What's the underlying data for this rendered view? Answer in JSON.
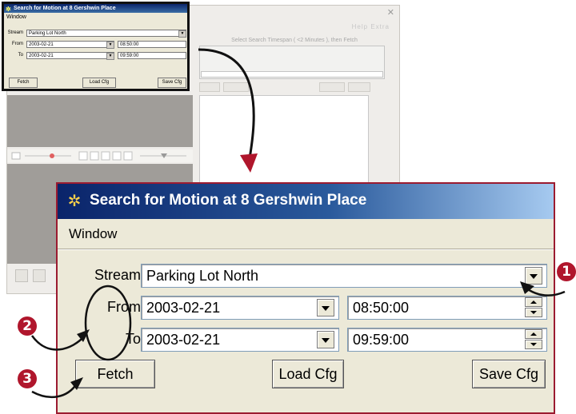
{
  "window": {
    "title": "Search for Motion at 8 Gershwin Place",
    "menu": "Window",
    "stream_label": "Stream",
    "stream_value": "Parking Lot North",
    "from_label": "From",
    "from_date": "2003-02-21",
    "from_time": "08:50:00",
    "to_label": "To",
    "to_date": "2003-02-21",
    "to_time": "09:59:00",
    "fetch_label": "Fetch",
    "load_label": "Load Cfg",
    "save_label": "Save Cfg"
  },
  "background": {
    "hint": "Select Search Timespan ( <2 Minutes ), then Fetch",
    "menu_right": "Help  Extra"
  },
  "callouts": [
    "1",
    "2",
    "3"
  ],
  "colors": {
    "callout": "#b0162c",
    "frame": "#9b1b30",
    "titlebar": "#0a246a"
  }
}
